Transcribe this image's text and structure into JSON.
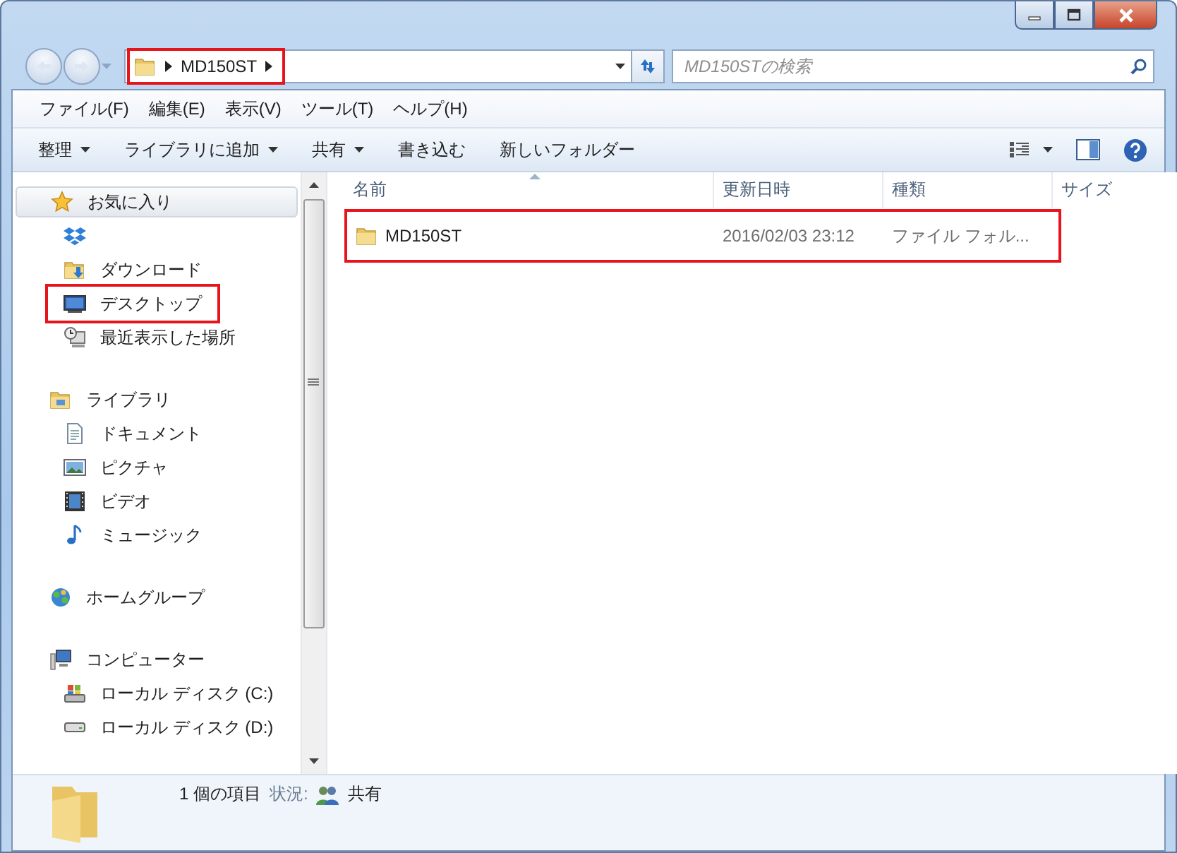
{
  "address": {
    "crumbs": [
      {
        "label": "MD150ST"
      }
    ],
    "highlighted": true
  },
  "search": {
    "placeholder": "MD150STの検索"
  },
  "menu": [
    "ファイル(F)",
    "編集(E)",
    "表示(V)",
    "ツール(T)",
    "ヘルプ(H)"
  ],
  "toolbar": [
    {
      "label": "整理",
      "dropdown": true
    },
    {
      "label": "ライブラリに追加",
      "dropdown": true
    },
    {
      "label": "共有",
      "dropdown": true
    },
    {
      "label": "書き込む",
      "dropdown": false
    },
    {
      "label": "新しいフォルダー",
      "dropdown": false
    }
  ],
  "nav": [
    {
      "label": "お気に入り",
      "kind": "star",
      "selected": true,
      "children": [
        {
          "kind": "dropbox",
          "selected": false,
          "highlighted": false
        },
        {
          "label": "ダウンロード",
          "kind": "download",
          "selected": false,
          "highlighted": false
        },
        {
          "label": "デスクトップ",
          "kind": "desktop",
          "selected": false,
          "highlighted": true
        },
        {
          "label": "最近表示した場所",
          "kind": "recent",
          "selected": false,
          "highlighted": false
        }
      ]
    },
    {
      "label": "ライブラリ",
      "kind": "library",
      "selected": false,
      "children": [
        {
          "label": "ドキュメント",
          "kind": "document",
          "selected": false,
          "highlighted": false
        },
        {
          "label": "ピクチャ",
          "kind": "picture",
          "selected": false,
          "highlighted": false
        },
        {
          "label": "ビデオ",
          "kind": "video",
          "selected": false,
          "highlighted": false
        },
        {
          "label": "ミュージック",
          "kind": "music",
          "selected": false,
          "highlighted": false
        }
      ]
    },
    {
      "label": "ホームグループ",
      "kind": "homegroup",
      "selected": false
    },
    {
      "label": "コンピューター",
      "kind": "computer",
      "selected": false,
      "children": [
        {
          "label": "ローカル ディスク (C:)",
          "kind": "disk-c",
          "selected": false,
          "highlighted": false
        },
        {
          "label": "ローカル ディスク (D:)",
          "kind": "disk-d",
          "selected": false,
          "highlighted": false
        }
      ]
    }
  ],
  "columns": [
    {
      "label": "名前",
      "sorted": true
    },
    {
      "label": "更新日時",
      "sorted": false
    },
    {
      "label": "種類",
      "sorted": false
    },
    {
      "label": "サイズ",
      "sorted": false
    }
  ],
  "rows": [
    {
      "name": "MD150ST",
      "modified": "2016/02/03 23:12",
      "type": "ファイル フォル...",
      "highlighted": true
    }
  ],
  "status": {
    "count": "1 個の項目",
    "state_label": "状況:",
    "state": "共有"
  }
}
